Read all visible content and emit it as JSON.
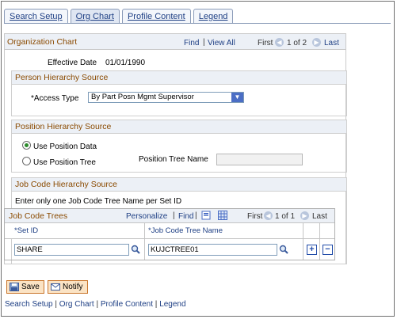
{
  "tabs": [
    {
      "label": "Search Setup",
      "active": false
    },
    {
      "label": "Org Chart",
      "active": true
    },
    {
      "label": "Profile Content",
      "active": false
    },
    {
      "label": "Legend",
      "active": false
    }
  ],
  "org_chart": {
    "title": "Organization Chart",
    "find": "Find",
    "view_all": "View All",
    "first": "First",
    "count": "1 of 2",
    "last": "Last",
    "effective_date_label": "Effective Date",
    "effective_date": "01/01/1990"
  },
  "person_hierarchy": {
    "title": "Person Hierarchy Source",
    "access_type_label": "*Access Type",
    "access_type_value": "By Part Posn Mgmt Supervisor"
  },
  "position_hierarchy": {
    "title": "Position Hierarchy Source",
    "use_position_data": "Use Position Data",
    "use_position_tree": "Use Position Tree",
    "selected": "Use Position Data",
    "position_tree_name_label": "Position Tree Name",
    "position_tree_name_value": ""
  },
  "job_code_hierarchy": {
    "title": "Job Code Hierarchy Source",
    "instruction": "Enter only one Job Code Tree Name per Set ID",
    "grid": {
      "title": "Job Code Trees",
      "personalize": "Personalize",
      "find": "Find",
      "first": "First",
      "count": "1 of 1",
      "last": "Last",
      "col_setid": "*Set ID",
      "col_tree": "*Job Code Tree Name",
      "rows": [
        {
          "setid": "SHARE",
          "tree": "KUJCTREE01"
        }
      ]
    }
  },
  "buttons": {
    "save": "Save",
    "notify": "Notify"
  },
  "bottom_links": [
    "Search Setup",
    "Org Chart",
    "Profile Content",
    "Legend"
  ],
  "colors": {
    "section_title": "#8a4a00",
    "link": "#1e3f84",
    "header_bg": "#ecf0f6",
    "button_bg": "#fbe3c4"
  }
}
